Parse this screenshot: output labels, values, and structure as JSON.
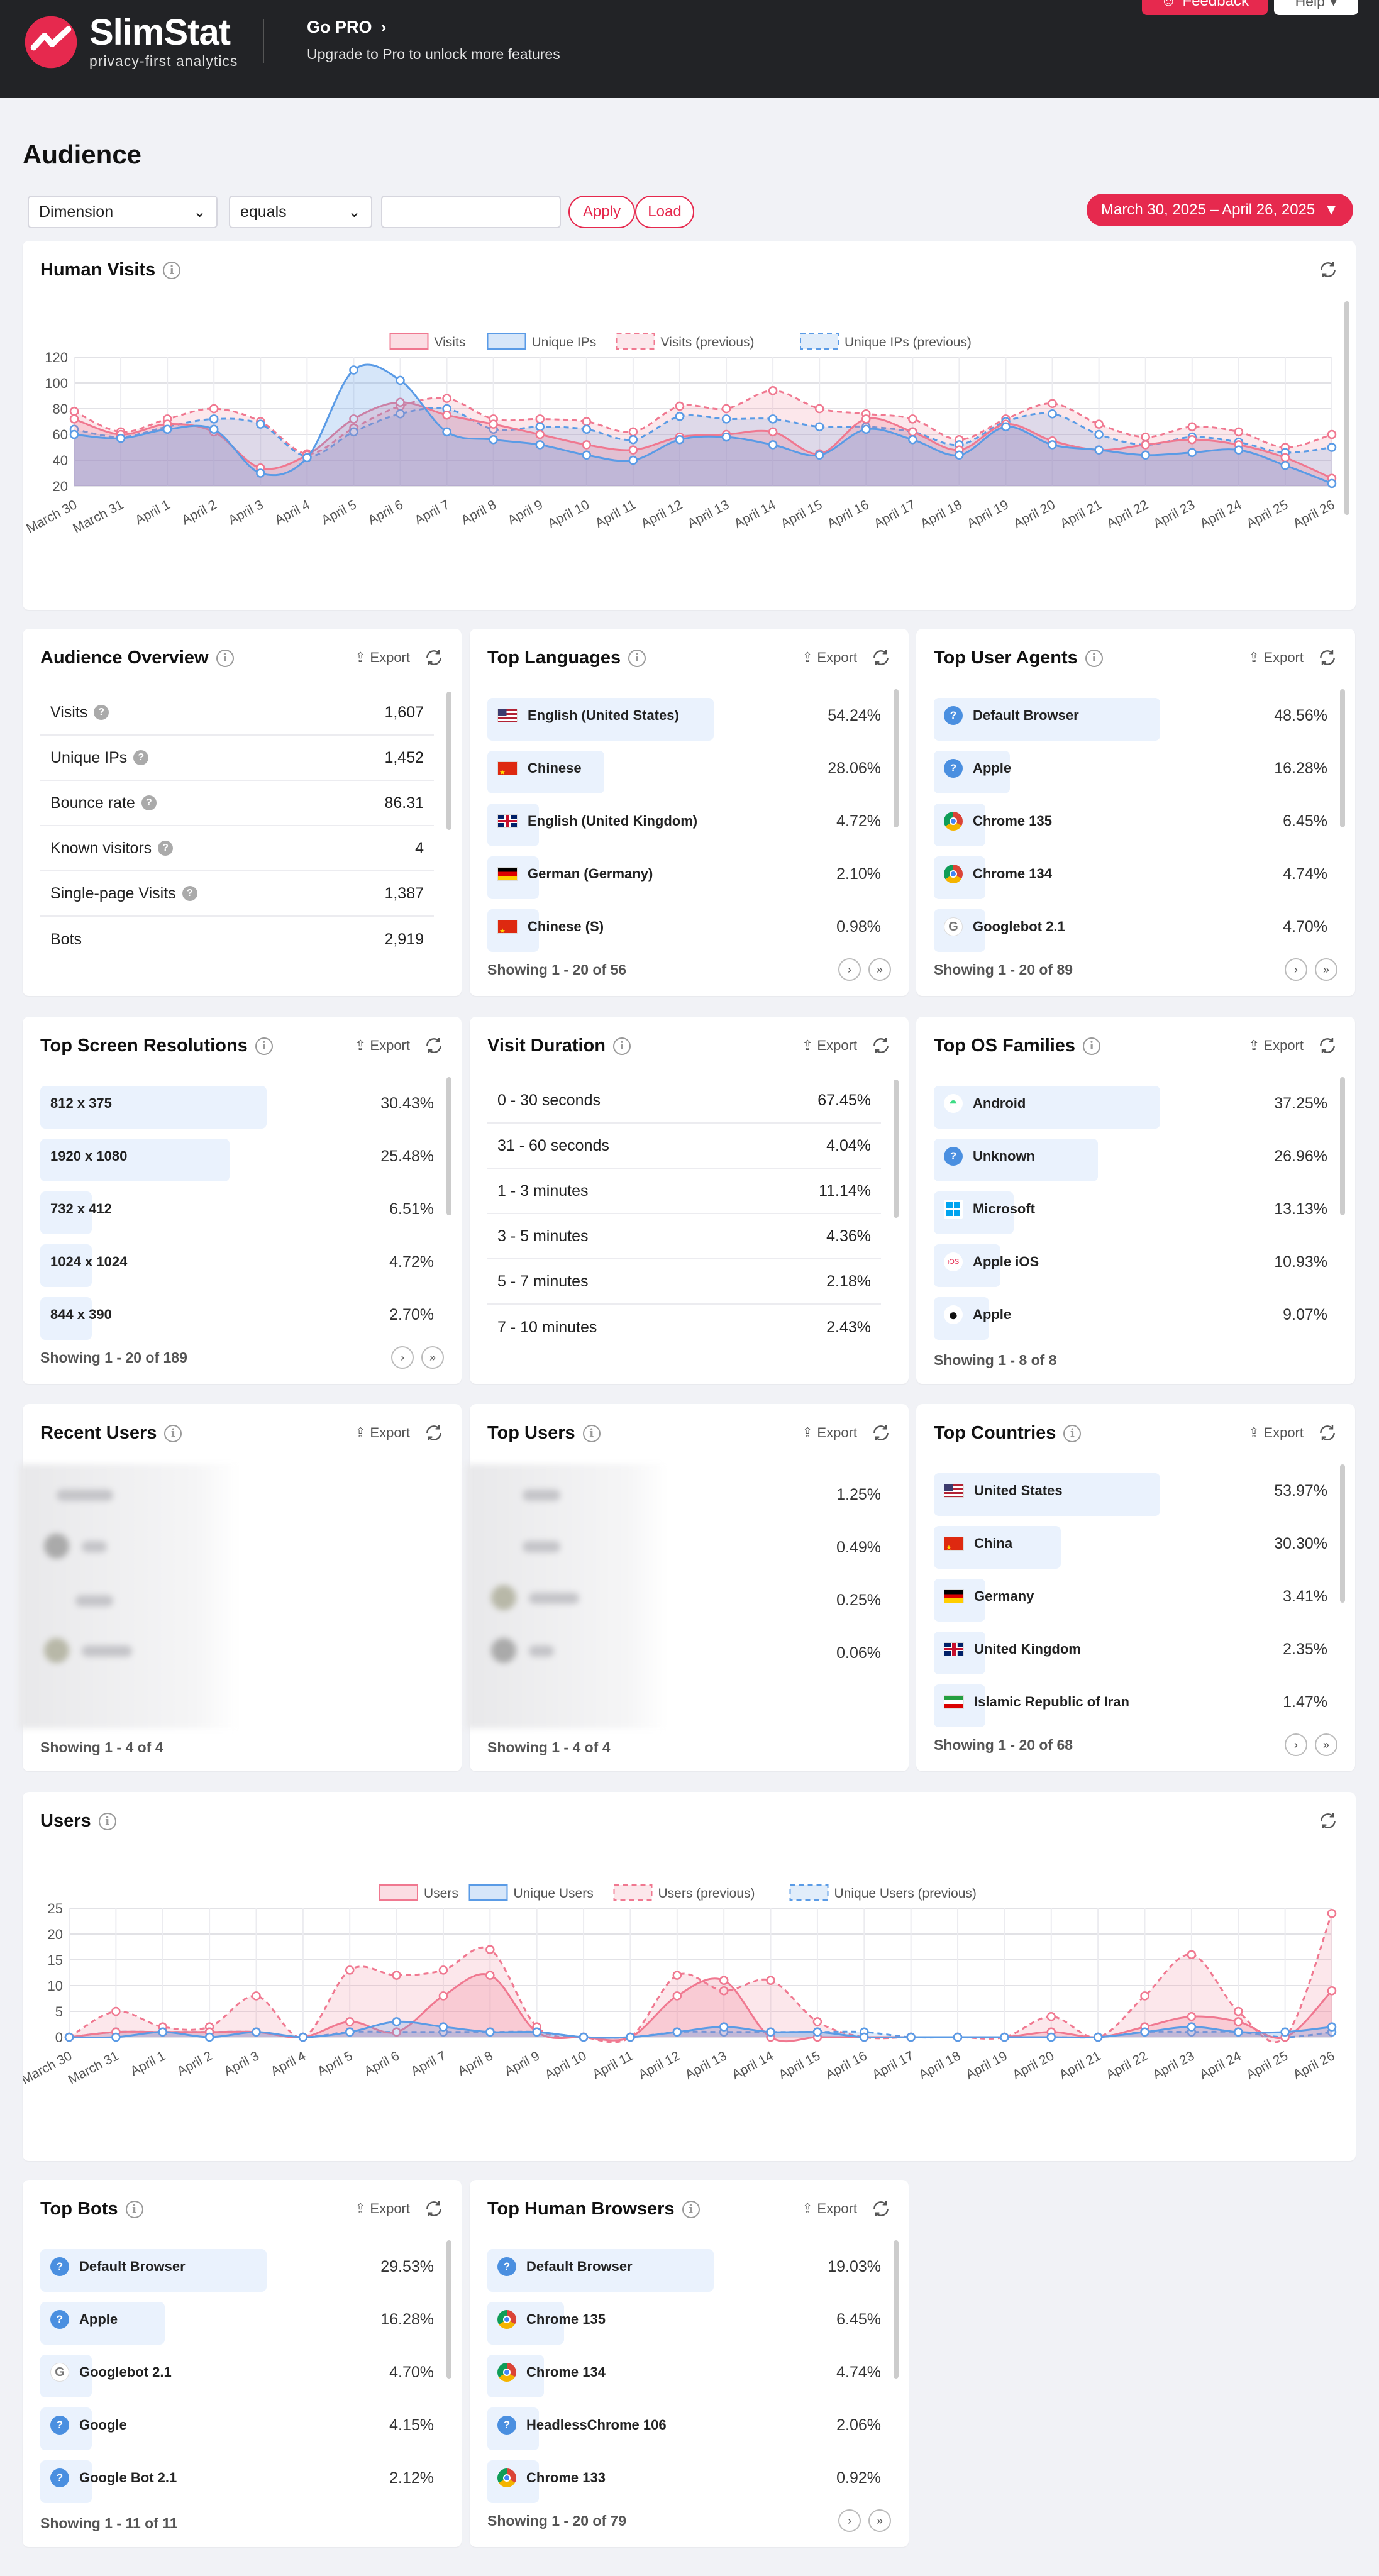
{
  "brand": {
    "name": "SlimStat",
    "tagline": "privacy-first analytics"
  },
  "gopro": {
    "title": "Go PRO",
    "subtitle": "Upgrade to Pro to unlock more features"
  },
  "topbar": {
    "feedback": "Feedback",
    "help": "Help"
  },
  "page": {
    "title": "Audience"
  },
  "filters": {
    "dimension": "Dimension",
    "operator": "equals",
    "value_placeholder": "",
    "apply": "Apply",
    "load": "Load",
    "date_range": "March 30, 2025 – April 26, 2025"
  },
  "common": {
    "export": "Export"
  },
  "colors": {
    "accent": "#e6294e",
    "visits": "#f07890",
    "unique": "#5a9be6"
  },
  "human_visits": {
    "title": "Human Visits",
    "legend": [
      "Visits",
      "Unique IPs",
      "Visits (previous)",
      "Unique IPs (previous)"
    ]
  },
  "users_chart": {
    "title": "Users",
    "legend": [
      "Users",
      "Unique Users",
      "Users (previous)",
      "Unique Users (previous)"
    ]
  },
  "chart_data": [
    {
      "type": "area",
      "title": "Human Visits",
      "x": [
        "March 30",
        "March 31",
        "April 1",
        "April 2",
        "April 3",
        "April 4",
        "April 5",
        "April 6",
        "April 7",
        "April 8",
        "April 9",
        "April 10",
        "April 11",
        "April 12",
        "April 13",
        "April 14",
        "April 15",
        "April 16",
        "April 17",
        "April 18",
        "April 19",
        "April 20",
        "April 21",
        "April 22",
        "April 23",
        "April 24",
        "April 25",
        "April 26"
      ],
      "ylim": [
        20,
        120
      ],
      "yticks": [
        20,
        40,
        60,
        80,
        100,
        120
      ],
      "series": [
        {
          "name": "Visits",
          "values": [
            72,
            60,
            68,
            62,
            34,
            44,
            72,
            85,
            75,
            68,
            60,
            52,
            48,
            58,
            60,
            62,
            45,
            72,
            62,
            48,
            68,
            55,
            48,
            52,
            56,
            52,
            42,
            26
          ]
        },
        {
          "name": "Unique IPs",
          "values": [
            60,
            57,
            64,
            64,
            30,
            42,
            110,
            102,
            62,
            56,
            52,
            44,
            40,
            56,
            58,
            52,
            44,
            64,
            56,
            44,
            66,
            52,
            48,
            44,
            46,
            48,
            36,
            22
          ]
        },
        {
          "name": "Visits (previous)",
          "values": [
            78,
            62,
            72,
            80,
            70,
            45,
            65,
            82,
            88,
            72,
            72,
            70,
            62,
            82,
            80,
            94,
            80,
            76,
            72,
            56,
            72,
            84,
            68,
            58,
            66,
            62,
            50,
            60
          ]
        },
        {
          "name": "Unique IPs (previous)",
          "values": [
            64,
            58,
            66,
            72,
            68,
            43,
            62,
            76,
            80,
            64,
            66,
            64,
            56,
            74,
            72,
            72,
            66,
            66,
            62,
            52,
            70,
            76,
            60,
            52,
            58,
            54,
            46,
            50
          ]
        }
      ]
    },
    {
      "type": "area",
      "title": "Users",
      "x": [
        "March 30",
        "March 31",
        "April 1",
        "April 2",
        "April 3",
        "April 4",
        "April 5",
        "April 6",
        "April 7",
        "April 8",
        "April 9",
        "April 10",
        "April 11",
        "April 12",
        "April 13",
        "April 14",
        "April 15",
        "April 16",
        "April 17",
        "April 18",
        "April 19",
        "April 20",
        "April 21",
        "April 22",
        "April 23",
        "April 24",
        "April 25",
        "April 26"
      ],
      "ylim": [
        0,
        25
      ],
      "yticks": [
        0,
        5,
        10,
        15,
        20,
        25
      ],
      "series": [
        {
          "name": "Users",
          "values": [
            0,
            1,
            1,
            1,
            1,
            0,
            3,
            1,
            8,
            12,
            1,
            0,
            0,
            8,
            11,
            0,
            0,
            0,
            0,
            0,
            0,
            1,
            0,
            2,
            4,
            3,
            0,
            9
          ]
        },
        {
          "name": "Unique Users",
          "values": [
            0,
            0,
            1,
            0,
            1,
            0,
            1,
            3,
            2,
            1,
            1,
            0,
            0,
            1,
            2,
            1,
            1,
            0,
            0,
            0,
            0,
            0,
            0,
            1,
            2,
            1,
            1,
            2
          ]
        },
        {
          "name": "Users (previous)",
          "values": [
            0,
            5,
            2,
            2,
            8,
            0,
            13,
            12,
            13,
            17,
            2,
            0,
            0,
            12,
            9,
            11,
            3,
            0,
            0,
            0,
            0,
            4,
            0,
            8,
            16,
            5,
            0,
            24
          ]
        },
        {
          "name": "Unique Users (previous)",
          "values": [
            0,
            1,
            1,
            1,
            1,
            0,
            1,
            1,
            1,
            1,
            1,
            0,
            0,
            1,
            1,
            1,
            1,
            1,
            0,
            0,
            0,
            0,
            0,
            1,
            1,
            1,
            0,
            1
          ]
        }
      ]
    }
  ],
  "audience_overview": {
    "title": "Audience Overview",
    "rows": [
      {
        "label": "Visits",
        "value": "1,607"
      },
      {
        "label": "Unique IPs",
        "value": "1,452"
      },
      {
        "label": "Bounce rate",
        "value": "86.31"
      },
      {
        "label": "Known visitors",
        "value": "4"
      },
      {
        "label": "Single-page Visits",
        "value": "1,387"
      },
      {
        "label": "Bots",
        "value": "2,919"
      }
    ]
  },
  "top_languages": {
    "title": "Top Languages",
    "rows": [
      {
        "label": "English (United States)",
        "value": "54.24%",
        "flag": "us",
        "pct": 54.24
      },
      {
        "label": "Chinese",
        "value": "28.06%",
        "flag": "cn",
        "pct": 28.06
      },
      {
        "label": "English (United Kingdom)",
        "value": "4.72%",
        "flag": "gb",
        "pct": 4.72
      },
      {
        "label": "German (Germany)",
        "value": "2.10%",
        "flag": "de",
        "pct": 2.1
      },
      {
        "label": "Chinese (S)",
        "value": "0.98%",
        "flag": "cn",
        "pct": 0.98
      }
    ],
    "showing": "Showing 1 - 20 of 56"
  },
  "top_user_agents": {
    "title": "Top User Agents",
    "rows": [
      {
        "label": "Default Browser",
        "value": "48.56%",
        "icon": "default",
        "pct": 48.56
      },
      {
        "label": "Apple",
        "value": "16.28%",
        "icon": "default",
        "pct": 16.28
      },
      {
        "label": "Chrome 135",
        "value": "6.45%",
        "icon": "chrome",
        "pct": 6.45
      },
      {
        "label": "Chrome 134",
        "value": "4.74%",
        "icon": "chrome",
        "pct": 4.74
      },
      {
        "label": "Googlebot 2.1",
        "value": "4.70%",
        "icon": "google",
        "pct": 4.7
      }
    ],
    "showing": "Showing 1 - 20 of 89"
  },
  "top_screen_resolutions": {
    "title": "Top Screen Resolutions",
    "rows": [
      {
        "label": "812 x 375",
        "value": "30.43%",
        "pct": 30.43
      },
      {
        "label": "1920 x 1080",
        "value": "25.48%",
        "pct": 25.48
      },
      {
        "label": "732 x 412",
        "value": "6.51%",
        "pct": 6.51
      },
      {
        "label": "1024 x 1024",
        "value": "4.72%",
        "pct": 4.72
      },
      {
        "label": "844 x 390",
        "value": "2.70%",
        "pct": 2.7
      }
    ],
    "showing": "Showing 1 - 20 of 189"
  },
  "visit_duration": {
    "title": "Visit Duration",
    "rows": [
      {
        "label": "0 - 30 seconds",
        "value": "67.45%"
      },
      {
        "label": "31 - 60 seconds",
        "value": "4.04%"
      },
      {
        "label": "1 - 3 minutes",
        "value": "11.14%"
      },
      {
        "label": "3 - 5 minutes",
        "value": "4.36%"
      },
      {
        "label": "5 - 7 minutes",
        "value": "2.18%"
      },
      {
        "label": "7 - 10 minutes",
        "value": "2.43%"
      }
    ]
  },
  "top_os_families": {
    "title": "Top OS Families",
    "rows": [
      {
        "label": "Android",
        "value": "37.25%",
        "icon": "android",
        "pct": 37.25
      },
      {
        "label": "Unknown",
        "value": "26.96%",
        "icon": "default",
        "pct": 26.96
      },
      {
        "label": "Microsoft",
        "value": "13.13%",
        "icon": "windows",
        "pct": 13.13
      },
      {
        "label": "Apple iOS",
        "value": "10.93%",
        "icon": "ios",
        "pct": 10.93
      },
      {
        "label": "Apple",
        "value": "9.07%",
        "icon": "apple",
        "pct": 9.07
      }
    ],
    "showing": "Showing 1 - 8 of 8"
  },
  "recent_users": {
    "title": "Recent Users",
    "showing": "Showing 1 - 4 of 4"
  },
  "top_users": {
    "title": "Top Users",
    "values": [
      "1.25%",
      "0.49%",
      "0.25%",
      "0.06%"
    ],
    "showing": "Showing 1 - 4 of 4"
  },
  "top_countries": {
    "title": "Top Countries",
    "rows": [
      {
        "label": "United States",
        "value": "53.97%",
        "flag": "us",
        "pct": 53.97
      },
      {
        "label": "China",
        "value": "30.30%",
        "flag": "cn",
        "pct": 30.3
      },
      {
        "label": "Germany",
        "value": "3.41%",
        "flag": "de",
        "pct": 3.41
      },
      {
        "label": "United Kingdom",
        "value": "2.35%",
        "flag": "gb",
        "pct": 2.35
      },
      {
        "label": "Islamic Republic of Iran",
        "value": "1.47%",
        "flag": "ir",
        "pct": 1.47
      }
    ],
    "showing": "Showing 1 - 20 of 68"
  },
  "top_bots": {
    "title": "Top Bots",
    "rows": [
      {
        "label": "Default Browser",
        "value": "29.53%",
        "icon": "default",
        "pct": 29.53
      },
      {
        "label": "Apple",
        "value": "16.28%",
        "icon": "default",
        "pct": 16.28
      },
      {
        "label": "Googlebot 2.1",
        "value": "4.70%",
        "icon": "google",
        "pct": 4.7
      },
      {
        "label": "Google",
        "value": "4.15%",
        "icon": "default",
        "pct": 4.15
      },
      {
        "label": "Google Bot 2.1",
        "value": "2.12%",
        "icon": "default",
        "pct": 2.12
      }
    ],
    "showing": "Showing 1 - 11 of 11"
  },
  "top_human_browsers": {
    "title": "Top Human Browsers",
    "rows": [
      {
        "label": "Default Browser",
        "value": "19.03%",
        "icon": "default",
        "pct": 19.03
      },
      {
        "label": "Chrome 135",
        "value": "6.45%",
        "icon": "chrome",
        "pct": 6.45
      },
      {
        "label": "Chrome 134",
        "value": "4.74%",
        "icon": "chrome",
        "pct": 4.74
      },
      {
        "label": "HeadlessChrome 106",
        "value": "2.06%",
        "icon": "default",
        "pct": 2.06
      },
      {
        "label": "Chrome 133",
        "value": "0.92%",
        "icon": "chrome",
        "pct": 0.92
      }
    ],
    "showing": "Showing 1 - 20 of 79"
  }
}
